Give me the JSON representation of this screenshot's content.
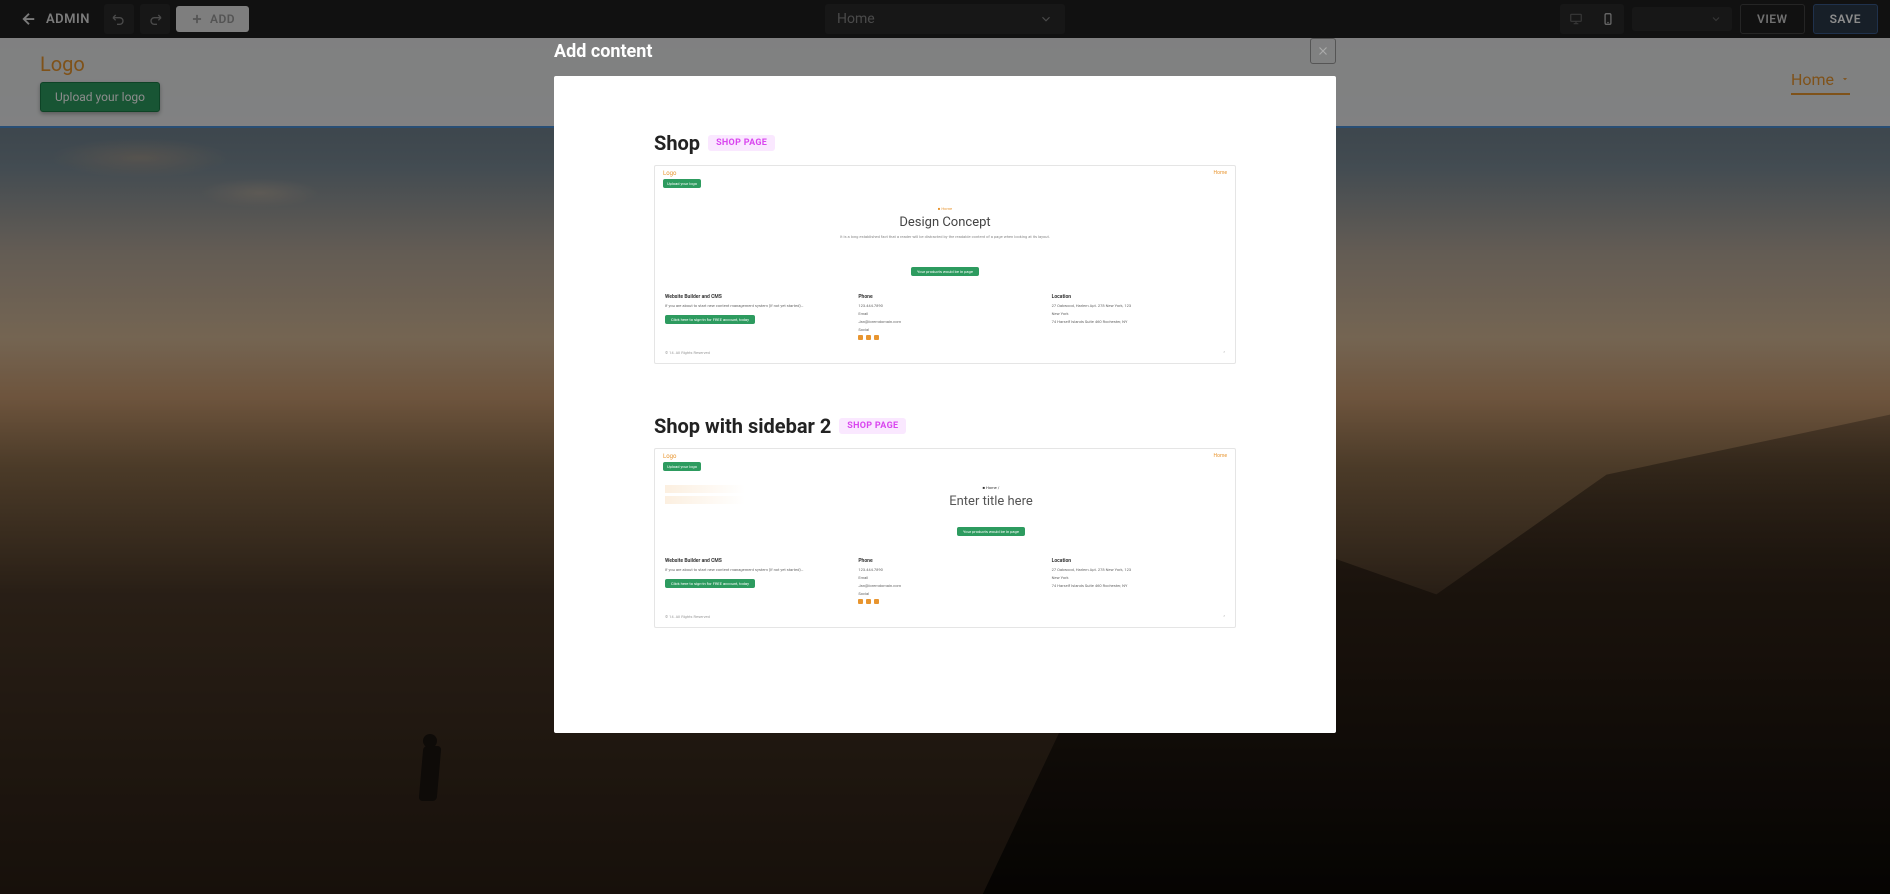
{
  "toolbar": {
    "admin_label": "ADMIN",
    "add_label": "ADD",
    "page_selected": "Home",
    "view_label": "VIEW",
    "save_label": "SAVE"
  },
  "site": {
    "logo_text": "Logo",
    "upload_logo_label": "Upload your logo",
    "nav_home": "Home"
  },
  "modal": {
    "title": "Add content",
    "templates": [
      {
        "name": "Shop",
        "badge": "SHOP PAGE",
        "preview": {
          "logo": "Logo",
          "upload": "Upload your logo",
          "nav": "Home",
          "hero_tag": "■ Home",
          "hero_title": "Design Concept",
          "hero_sub": "It is a long established fact that a reader will be distracted by the readable content of a page when looking at its layout.",
          "cta": "Your products would be in page",
          "footer": {
            "col1_title": "Website Builder and CMS",
            "col1_text": "If you are about to start new content management system (if not yet started)…",
            "col1_cta": "Click here to sign-in for FREE account, today",
            "col2_title": "Phone",
            "col2_phone": "123.444.7890",
            "col2_email_label": "Email",
            "col2_email": "Jan@loremdomain.com",
            "col2_social": "Social",
            "col3_title": "Location",
            "col3_addr1": "27 Oakwood, Harlem Apt. 278 New York, 123",
            "col3_addr2": "New York",
            "col3_addr3": "74 Harself Islands Suite 460 Rochester, NY"
          },
          "copyright": "© 14. All Rights Reserved"
        }
      },
      {
        "name": "Shop with sidebar 2",
        "badge": "SHOP PAGE",
        "preview": {
          "logo": "Logo",
          "upload": "Upload your logo",
          "nav": "Home",
          "main_tag": "■ Home /",
          "main_title": "Enter title here",
          "cta": "Your products would be in page",
          "footer": {
            "col1_title": "Website Builder and CMS",
            "col1_text": "If you are about to start new content management system (if not yet started)…",
            "col1_cta": "Click here to sign-in for FREE account, today",
            "col2_title": "Phone",
            "col2_phone": "123.444.7890",
            "col2_email_label": "Email",
            "col2_email": "Jan@loremdomain.com",
            "col2_social": "Social",
            "col3_title": "Location",
            "col3_addr1": "27 Oakwood, Harlem Apt. 278 New York, 123",
            "col3_addr2": "New York",
            "col3_addr3": "74 Harself Islands Suite 460 Rochester, NY"
          },
          "copyright": "© 14. All Rights Reserved"
        }
      }
    ]
  }
}
